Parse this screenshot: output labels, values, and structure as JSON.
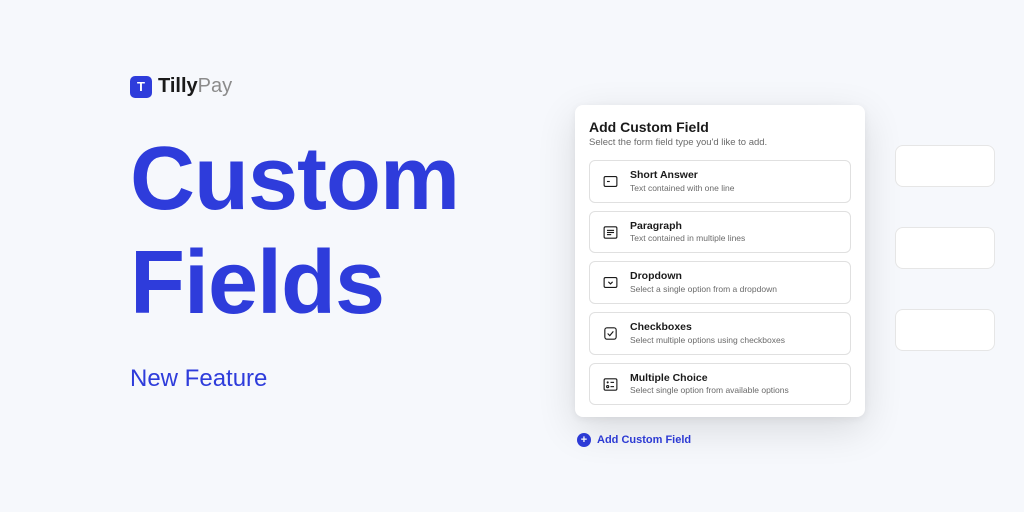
{
  "brand": {
    "logo_letter": "T",
    "name_bold": "Tilly",
    "name_light": "Pay"
  },
  "hero": {
    "headline_line1": "Custom",
    "headline_line2": "Fields",
    "subheadline": "New Feature"
  },
  "modal": {
    "title": "Add Custom Field",
    "subtitle": "Select the form field type you'd like to add.",
    "options": [
      {
        "label": "Short Answer",
        "desc": "Text contained with one line"
      },
      {
        "label": "Paragraph",
        "desc": "Text contained in multiple lines"
      },
      {
        "label": "Dropdown",
        "desc": "Select a single option from a dropdown"
      },
      {
        "label": "Checkboxes",
        "desc": "Select multiple options using checkboxes"
      },
      {
        "label": "Multiple Choice",
        "desc": "Select single option from available options"
      }
    ]
  },
  "add_button": {
    "label": "Add Custom Field",
    "plus": "+"
  }
}
